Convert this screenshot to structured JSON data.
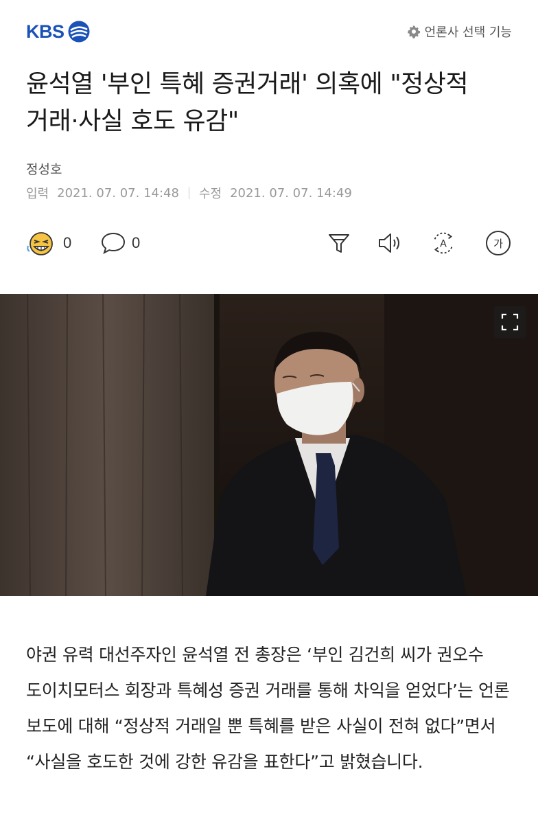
{
  "header": {
    "logo_text": "KBS",
    "press_select_label": "언론사 선택 기능"
  },
  "article": {
    "title": "윤석열 '부인 특혜 증권거래' 의혹에 \"정상적 거래·사실 호도 유감\"",
    "author": "정성호",
    "input_label": "입력",
    "input_date": "2021. 07. 07. 14:48",
    "modified_label": "수정",
    "modified_date": "2021. 07. 07. 14:49",
    "body": "야권 유력 대선주자인 윤석열 전 총장은 ‘부인 김건희 씨가 권오수 도이치모터스 회장과 특혜성 증권 거래를 통해 차익을 얻었다’는 언론 보도에 대해 “정상적 거래일 뿐 특혜를 받은 사실이 전혀 없다”면서 “사실을 호도한 것에 강한 유감을 표한다”고 밝혔습니다."
  },
  "actions": {
    "reaction_icon": "laughing-face-icon",
    "reaction_count": "0",
    "comment_icon": "speech-bubble-icon",
    "comment_count": "0",
    "tools": [
      "filter-icon",
      "speaker-icon",
      "translate-icon",
      "font-size-icon"
    ],
    "font_size_glyph": "가",
    "translate_glyph": "A"
  },
  "colors": {
    "brand_blue": "#1a52b8",
    "reaction_yellow": "#f6c343"
  }
}
